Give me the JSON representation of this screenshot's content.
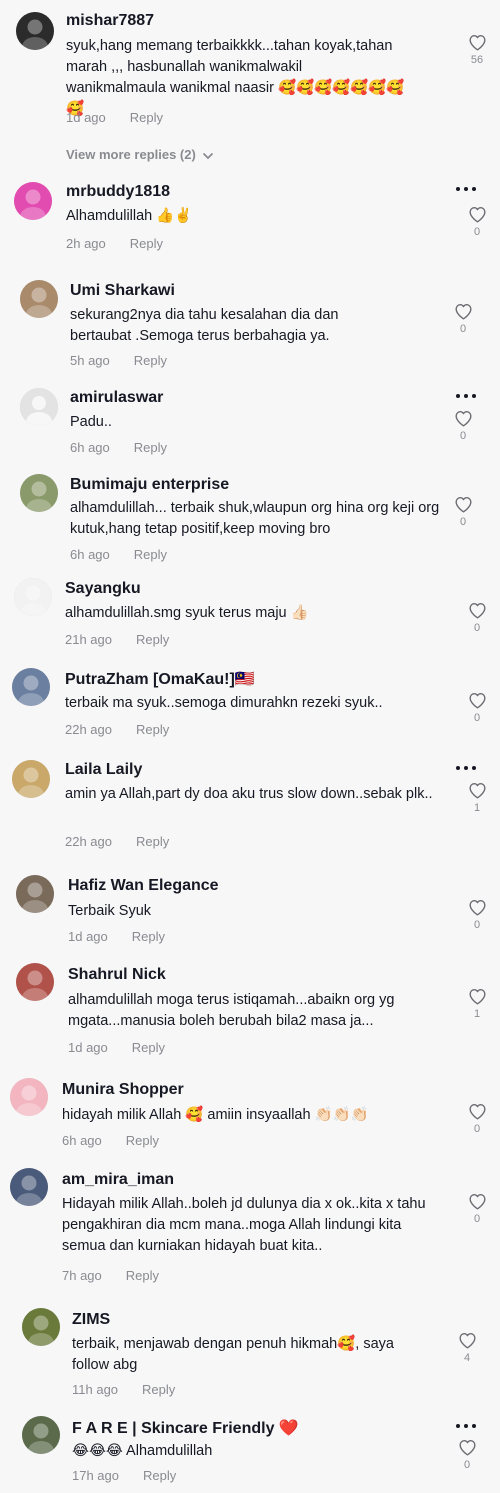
{
  "comments": [
    {
      "username": "mishar7887",
      "text": "syuk,hang memang terbaikkkk...tahan koyak,tahan marah ,,, hasbunallah wanikmalwakil wanikmalmaula wanikmal naasir 🥰🥰🥰🥰🥰🥰🥰🥰",
      "time": "1d ago",
      "reply": "Reply",
      "likes": "56",
      "avatar_color": "#2b2b2b"
    },
    {
      "username": "mrbuddy1818",
      "text": "Alhamdulillah 👍✌️",
      "time": "2h ago",
      "reply": "Reply",
      "likes": "0",
      "avatar_color": "#e24bb0"
    },
    {
      "username": "Umi Sharkawi",
      "text": "sekurang2nya dia tahu kesalahan dia dan bertaubat .Semoga terus berbahagia ya.",
      "time": "5h ago",
      "reply": "Reply",
      "likes": "0",
      "avatar_color": "#a98b6c"
    },
    {
      "username": "amirulaswar",
      "text": "Padu..",
      "time": "6h ago",
      "reply": "Reply",
      "likes": "0",
      "avatar_color": "#d6d6d6"
    },
    {
      "username": "Bumimaju enterprise",
      "text": "alhamdulillah... terbaik shuk,wlaupun org hina org keji org kutuk,hang tetap positif,keep moving bro",
      "time": "6h ago",
      "reply": "Reply",
      "likes": "0",
      "avatar_color": "#8a9a6a"
    },
    {
      "username": "Sayangku",
      "text": "alhamdulillah.smg syuk terus maju 👍🏻",
      "time": "21h ago",
      "reply": "Reply",
      "likes": "0",
      "avatar_color": "#f2f2f2"
    },
    {
      "username": "PutraZham [OmaKau!]🇲🇾",
      "text": "terbaik ma syuk..semoga dimurahkn rezeki syuk..",
      "time": "22h ago",
      "reply": "Reply",
      "likes": "0",
      "avatar_color": "#6b7fa0"
    },
    {
      "username": "Laila Laily",
      "text": "amin ya Allah,part dy doa aku trus slow down..sebak plk..",
      "time": "22h ago",
      "reply": "Reply",
      "likes": "1",
      "avatar_color": "#c9a86a"
    },
    {
      "username": "Hafiz Wan Elegance",
      "text": "Terbaik Syuk",
      "time": "1d ago",
      "reply": "Reply",
      "likes": "0",
      "avatar_color": "#7a6a5a"
    },
    {
      "username": "Shahrul Nick",
      "text": "alhamdulillah moga terus istiqamah...abaikn org yg mgata...manusia boleh berubah bila2 masa ja...",
      "time": "1d ago",
      "reply": "Reply",
      "likes": "1",
      "avatar_color": "#b0524a"
    },
    {
      "username": "Munira Shopper",
      "text": "hidayah milik Allah 🥰 amiin insyaallah 👏🏻👏🏻👏🏻",
      "time": "6h ago",
      "reply": "Reply",
      "likes": "0",
      "avatar_color": "#f3b6c0"
    },
    {
      "username": "am_mira_iman",
      "text": "Hidayah milik Allah..boleh jd dulunya dia x ok..kita x tahu pengakhiran dia mcm mana..moga Allah lindungi kita semua dan kurniakan hidayah buat kita..",
      "time": "7h ago",
      "reply": "Reply",
      "likes": "0",
      "avatar_color": "#4a5a7a"
    },
    {
      "username": "ZIMS",
      "text": "terbaik, menjawab dengan penuh hikmah🥰, saya follow abg",
      "time": "11h ago",
      "reply": "Reply",
      "likes": "4",
      "avatar_color": "#6a7a3a"
    },
    {
      "username": "F A R E | Skincare Friendly ❤️",
      "text": "😂😂😂 Alhamdulillah",
      "time": "17h ago",
      "reply": "Reply",
      "likes": "0",
      "avatar_color": "#5a6a4a"
    }
  ],
  "view_more_replies": "View more replies (2)",
  "colors": {
    "background": "#f7f7f7",
    "text": "#161823",
    "muted": "#8a8b91"
  }
}
